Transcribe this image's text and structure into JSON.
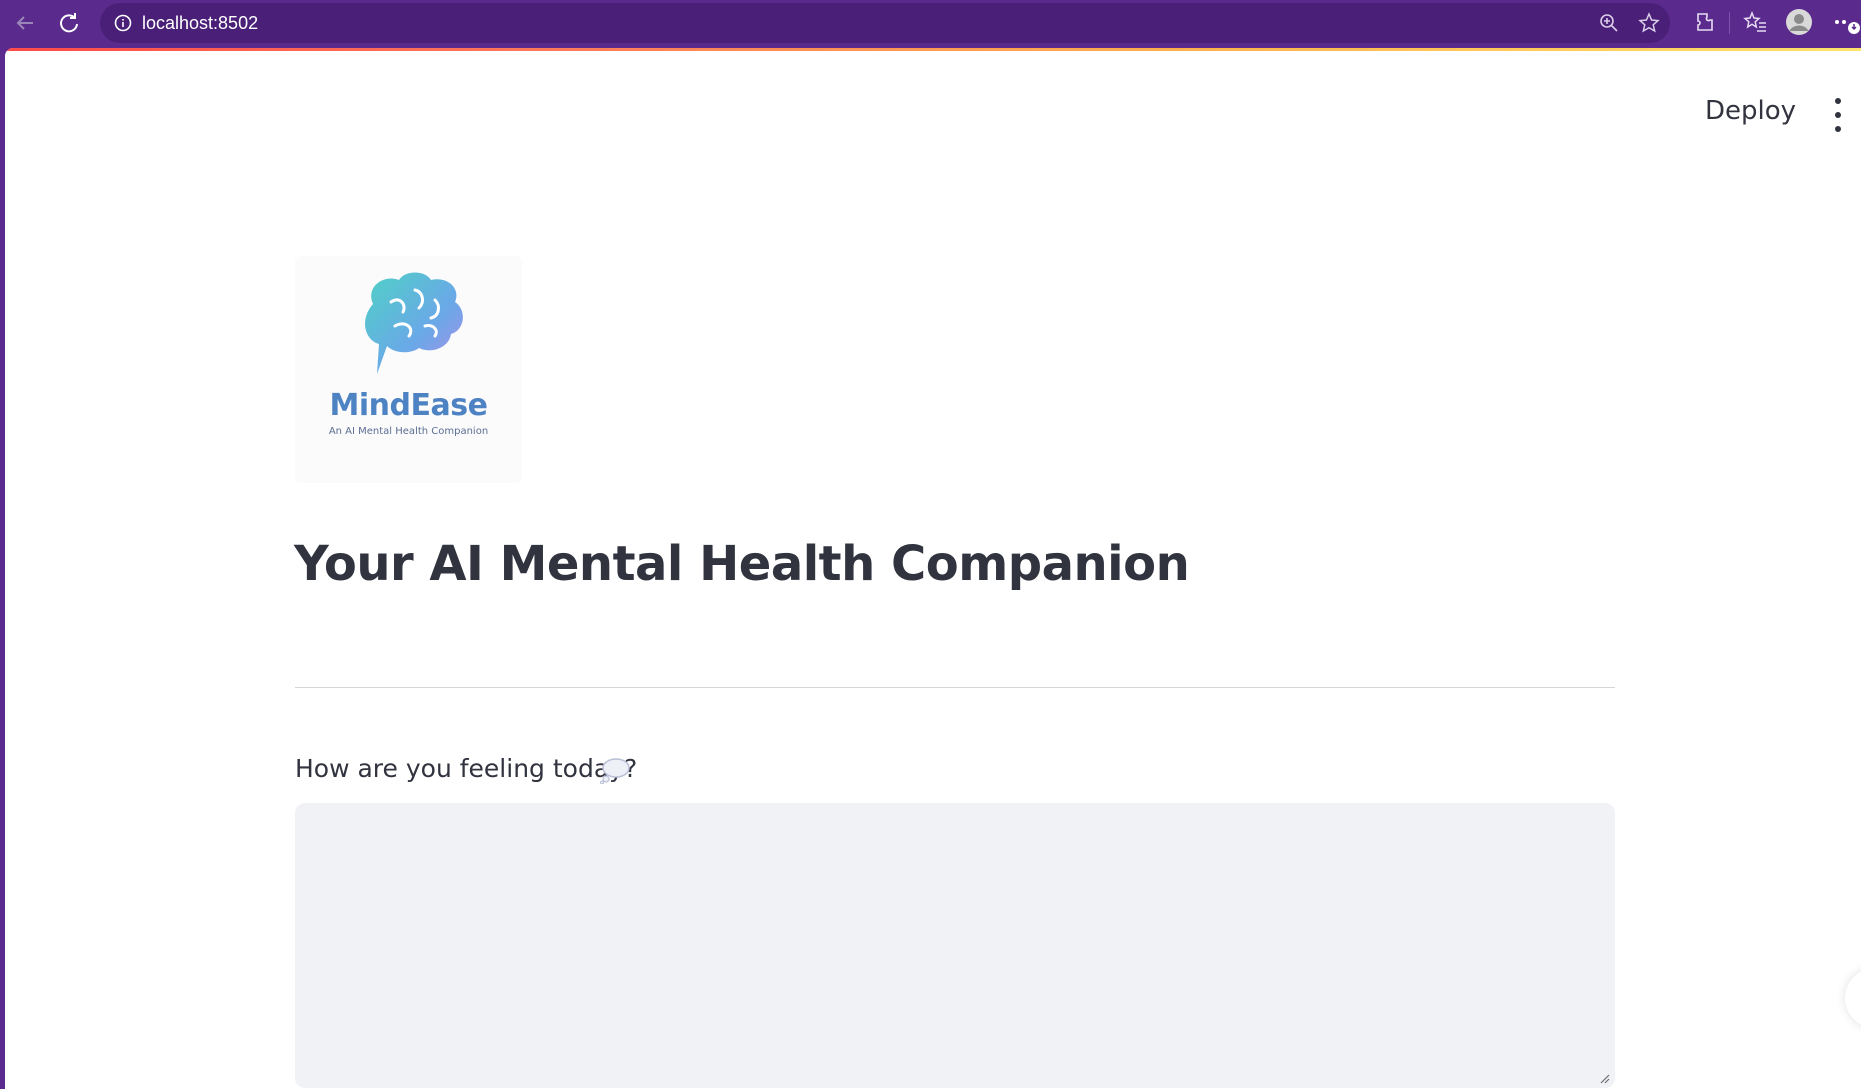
{
  "browser": {
    "url": "localhost:8502"
  },
  "header": {
    "deploy_label": "Deploy"
  },
  "logo": {
    "name": "MindEase",
    "tagline": "An AI Mental Health Companion"
  },
  "main": {
    "title": "Your AI Mental Health Companion",
    "input_label": "How are you feeling today?",
    "input_value": ""
  },
  "colors": {
    "browser_chrome": "#5a2a8d",
    "text_primary": "#31333f",
    "input_background": "#f0f2f6",
    "logo_blue": "#4d82c3"
  }
}
